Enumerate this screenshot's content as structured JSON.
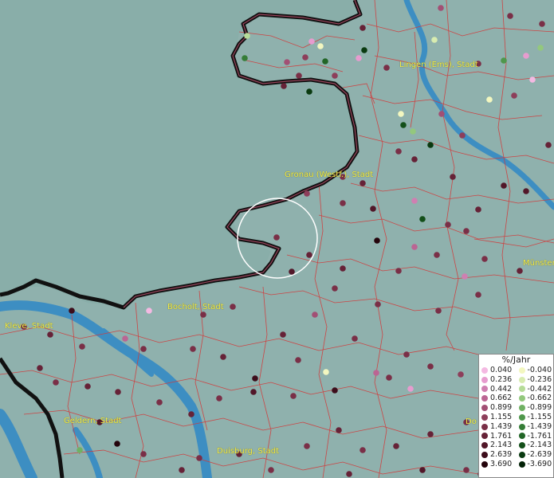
{
  "map": {
    "place_labels": [
      {
        "id": "lingen",
        "text": "Lingen (Ems), Stadt"
      },
      {
        "id": "gronau",
        "text": "Gronau (Westf.), Stadt"
      },
      {
        "id": "bocholt",
        "text": "Bocholt, Stadt"
      },
      {
        "id": "kleve",
        "text": "Kleve, Stadt"
      },
      {
        "id": "geldern",
        "text": "Geldern, Stadt"
      },
      {
        "id": "duisburg",
        "text": "Duisburg, Stadt"
      },
      {
        "id": "munster",
        "text": "Münster"
      },
      {
        "id": "do",
        "text": "Do"
      }
    ],
    "colors": {
      "background_land": "#8fb1ad",
      "sea_area": "#8aaea9",
      "river": "#3d8ec2",
      "border": "#111111",
      "district_lines": "#d23a3a",
      "label_text": "#f2ee4a",
      "selection_ring": "#ffffff"
    }
  },
  "legend": {
    "title": "%/Jahr",
    "positive": [
      {
        "value": "0.040",
        "color": "#f4b9e2"
      },
      {
        "value": "0.236",
        "color": "#e79ccf"
      },
      {
        "value": "0.442",
        "color": "#cf7fb1"
      },
      {
        "value": "0.662",
        "color": "#bb6593"
      },
      {
        "value": "0.899",
        "color": "#a24f74"
      },
      {
        "value": "1.155",
        "color": "#8d3e5a"
      },
      {
        "value": "1.439",
        "color": "#7a2f47"
      },
      {
        "value": "1.761",
        "color": "#662237"
      },
      {
        "value": "2.143",
        "color": "#521729"
      },
      {
        "value": "2.639",
        "color": "#3d0d1b"
      },
      {
        "value": "3.690",
        "color": "#25040c"
      }
    ],
    "negative": [
      {
        "value": "-0.040",
        "color": "#f3f7c0"
      },
      {
        "value": "-0.236",
        "color": "#d8ecb0"
      },
      {
        "value": "-0.442",
        "color": "#b6dc98"
      },
      {
        "value": "-0.662",
        "color": "#93c87d"
      },
      {
        "value": "-0.899",
        "color": "#70b163"
      },
      {
        "value": "-1.155",
        "color": "#4f974b"
      },
      {
        "value": "-1.439",
        "color": "#357d37"
      },
      {
        "value": "-1.761",
        "color": "#216526"
      },
      {
        "value": "-2.143",
        "color": "#134f19"
      },
      {
        "value": "-2.639",
        "color": "#0a3a10"
      },
      {
        "value": "-3.690",
        "color": "#032207"
      }
    ]
  }
}
